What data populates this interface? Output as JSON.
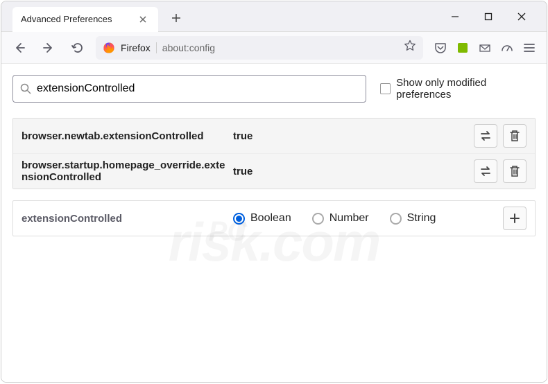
{
  "tab": {
    "title": "Advanced Preferences"
  },
  "urlbar": {
    "identity": "Firefox",
    "url": "about:config"
  },
  "search": {
    "value": "extensionControlled",
    "checkbox_label": "Show only modified preferences"
  },
  "prefs": [
    {
      "name": "browser.newtab.extensionControlled",
      "value": "true"
    },
    {
      "name": "browser.startup.homepage_override.extensionControlled",
      "value": "true"
    }
  ],
  "new_pref": {
    "name": "extensionControlled",
    "types": [
      "Boolean",
      "Number",
      "String"
    ],
    "selected": 0
  },
  "watermark": {
    "brand": "PC",
    "main": "risk.com"
  }
}
